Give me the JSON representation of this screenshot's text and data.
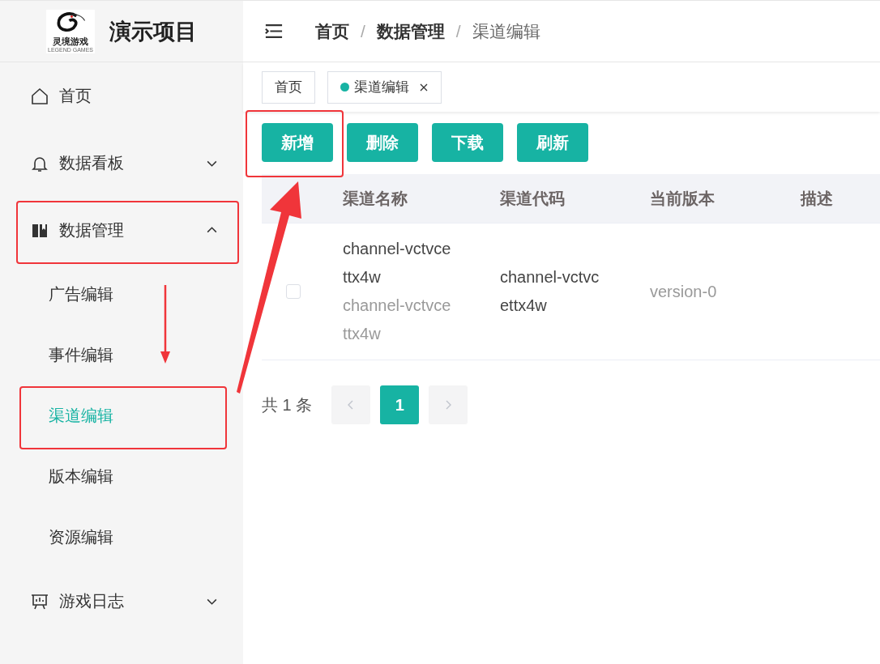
{
  "brand": {
    "logo_text": "灵境游戏",
    "logo_subtext": "LEGEND GAMES",
    "title": "演示项目"
  },
  "sidebar": {
    "items": [
      {
        "label": "首页",
        "selected": false
      },
      {
        "label": "数据看板",
        "selected": false,
        "expanded": false
      },
      {
        "label": "数据管理",
        "selected": false,
        "expanded": true,
        "children": [
          {
            "label": "广告编辑",
            "selected": false
          },
          {
            "label": "事件编辑",
            "selected": false
          },
          {
            "label": "渠道编辑",
            "selected": true
          },
          {
            "label": "版本编辑",
            "selected": false
          },
          {
            "label": "资源编辑",
            "selected": false
          }
        ]
      },
      {
        "label": "游戏日志",
        "selected": false,
        "expanded": false
      }
    ]
  },
  "breadcrumb": {
    "separator": "/",
    "items": [
      "首页",
      "数据管理",
      "渠道编辑"
    ]
  },
  "tabs": [
    {
      "label": "首页",
      "selected": false,
      "closable": false
    },
    {
      "label": "渠道编辑",
      "selected": true,
      "closable": true
    }
  ],
  "buttons": [
    {
      "label": "新增"
    },
    {
      "label": "删除"
    },
    {
      "label": "下载"
    },
    {
      "label": "刷新"
    }
  ],
  "table": {
    "columns": [
      "渠道名称",
      "渠道代码",
      "当前版本",
      "描述"
    ],
    "rows": [
      {
        "checked": false,
        "name": "channel-vctvcettx4w",
        "name_sub": "channel-vctvcettx4w",
        "code": "channel-vctvcettx4w",
        "version": "version-0"
      }
    ]
  },
  "pagination": {
    "total": "共 1 条",
    "pages": [
      {
        "label": "1",
        "selected": true
      }
    ]
  },
  "annotations": [
    {
      "kind": "box"
    },
    {
      "kind": "box"
    },
    {
      "kind": "box"
    },
    {
      "kind": "arrow"
    },
    {
      "kind": "arrow"
    }
  ]
}
